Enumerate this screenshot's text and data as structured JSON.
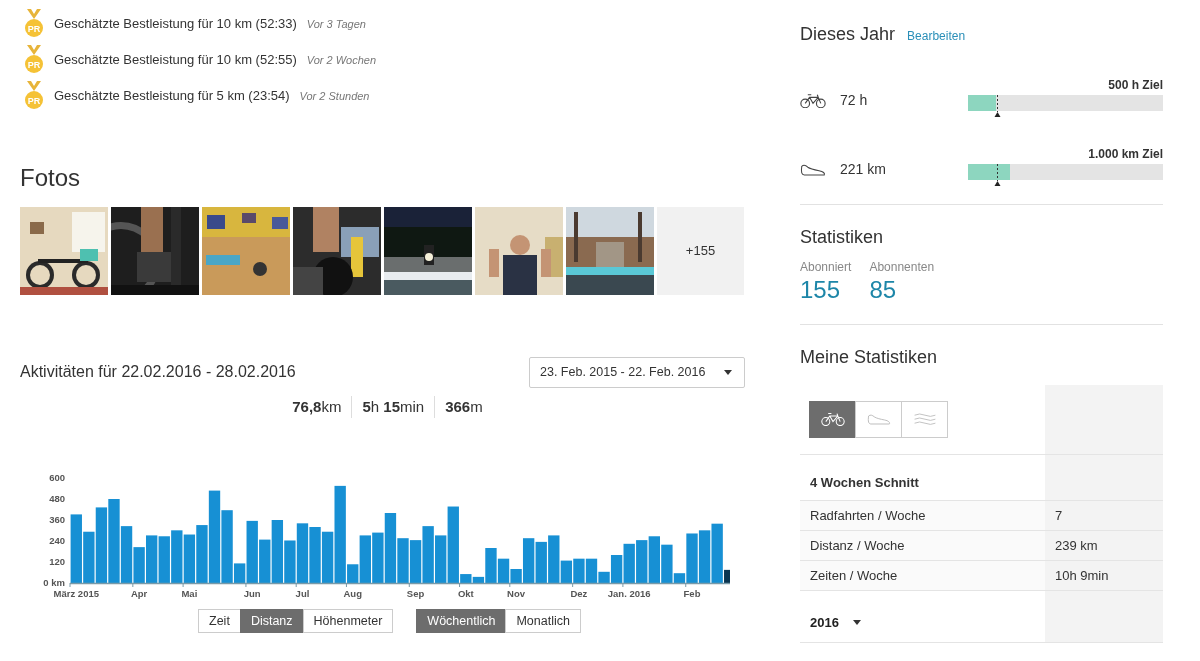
{
  "records": [
    {
      "badge": "PR",
      "text": "Geschätzte Bestleistung für 10 km (52:33)",
      "time": "Vor 3 Tagen"
    },
    {
      "badge": "PR",
      "text": "Geschätzte Bestleistung für 10 km (52:55)",
      "time": "Vor 2 Wochen"
    },
    {
      "badge": "PR",
      "text": "Geschätzte Bestleistung für 5 km (23:54)",
      "time": "Vor 2 Stunden"
    }
  ],
  "photos": {
    "title": "Fotos",
    "more": "+155"
  },
  "activities": {
    "title": "Aktivitäten für 22.02.2016 - 28.02.2016",
    "range": "23. Feb. 2015 - 22. Feb. 2016",
    "summary": [
      "**76,8**km",
      "**5**h **15**min",
      "**366**m"
    ],
    "chart_data": {
      "type": "bar",
      "categories": [
        "März 2015",
        null,
        null,
        null,
        null,
        "Apr",
        null,
        null,
        null,
        "Mai",
        null,
        null,
        null,
        null,
        "Jun",
        null,
        null,
        null,
        "Jul",
        null,
        null,
        null,
        "Aug",
        null,
        null,
        null,
        null,
        "Sep",
        null,
        null,
        null,
        "Okt",
        null,
        null,
        null,
        "Nov",
        null,
        null,
        null,
        null,
        "Dez",
        null,
        null,
        null,
        "Jan. 2016",
        null,
        null,
        null,
        null,
        "Feb",
        null,
        null,
        null
      ],
      "ylim": [
        0,
        600
      ],
      "yticks": [
        {
          "value": 0,
          "label": "0 km"
        },
        120,
        240,
        360,
        480,
        600
      ],
      "series": [
        {
          "color": "#1790d4",
          "values": [
            392,
            293,
            432,
            480,
            325,
            205,
            272,
            267,
            301,
            277,
            331,
            528,
            416,
            112,
            355,
            248,
            360,
            243,
            341,
            320,
            293,
            555,
            107,
            272,
            288,
            400,
            256,
            245,
            325,
            272,
            437,
            51,
            35,
            200,
            139,
            80,
            256,
            235,
            272,
            128,
            139,
            139,
            64,
            160,
            224,
            245,
            267,
            219,
            56,
            283,
            301,
            339,
            null
          ]
        },
        {
          "color": "#0b3550",
          "values": [
            null,
            null,
            null,
            null,
            null,
            null,
            null,
            null,
            null,
            null,
            null,
            null,
            null,
            null,
            null,
            null,
            null,
            null,
            null,
            null,
            null,
            null,
            null,
            null,
            null,
            null,
            null,
            null,
            null,
            null,
            null,
            null,
            null,
            null,
            null,
            null,
            null,
            null,
            null,
            null,
            null,
            null,
            null,
            null,
            null,
            null,
            null,
            null,
            null,
            null,
            null,
            null,
            75
          ]
        }
      ]
    },
    "metric_tabs": [
      {
        "label": "Zeit",
        "selected": false
      },
      {
        "label": "Distanz",
        "selected": true
      },
      {
        "label": "Höhenmeter",
        "selected": false
      }
    ],
    "period_tabs": [
      {
        "label": "Wöchentlich",
        "selected": true
      },
      {
        "label": "Monatlich",
        "selected": false
      }
    ]
  },
  "year": {
    "title": "Dieses Jahr",
    "edit": "Bearbeiten",
    "goals": [
      {
        "kind": "bike",
        "value": "72 h",
        "goal": "500 h Ziel",
        "level": 0.144,
        "pace": {
          "level": 0.148
        }
      },
      {
        "kind": "run",
        "value": "221 km",
        "goal": "1.000 km Ziel",
        "level": 0.215,
        "pace": {
          "level": 0.148
        }
      }
    ]
  },
  "stats": {
    "title": "Statistiken",
    "items": [
      {
        "label": "Abonniert",
        "value": "155"
      },
      {
        "label": "Abonnenten",
        "value": "85"
      }
    ]
  },
  "my_stats": {
    "title": "Meine Statistiken",
    "sports": [
      {
        "kind": "bike",
        "selected": true
      },
      {
        "kind": "run",
        "selected": false
      },
      {
        "kind": "swim",
        "selected": false
      }
    ],
    "section": "4 Wochen Schnitt",
    "rows": [
      {
        "label": "Radfahrten / Woche",
        "value": "7"
      },
      {
        "label": "Distanz / Woche",
        "value": "239 km"
      },
      {
        "label": "Zeiten / Woche",
        "value": "10h 9min"
      }
    ],
    "year": "2016"
  }
}
